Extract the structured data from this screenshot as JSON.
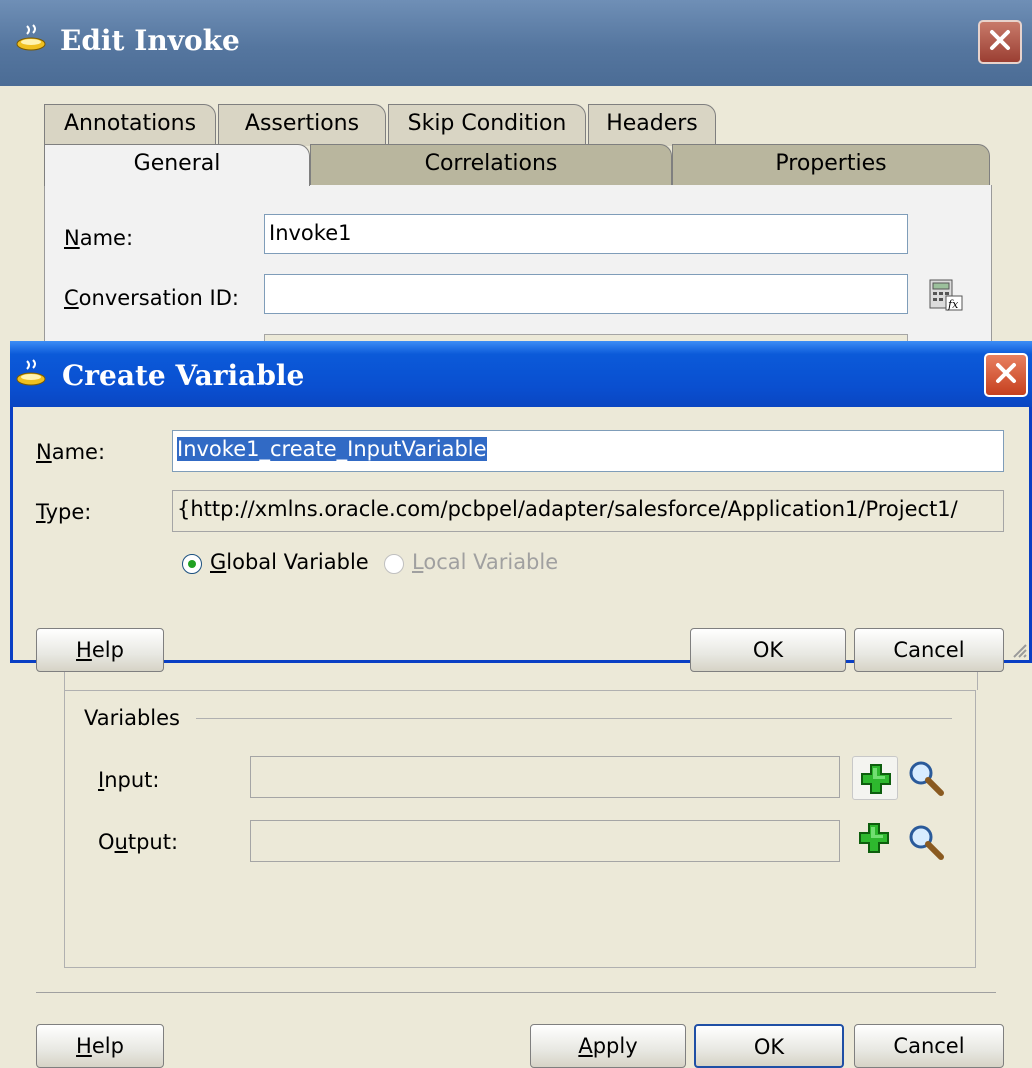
{
  "outer_dialog": {
    "title": "Edit Invoke",
    "tabs_row1": [
      "Annotations",
      "Assertions",
      "Skip Condition",
      "Headers"
    ],
    "tabs_row2": [
      "General",
      "Correlations",
      "Properties"
    ],
    "name_label": "Name:",
    "name_value": "Invoke1",
    "conversation_label": "Conversation ID:",
    "conversation_value": "",
    "variables": {
      "section_label": "Variables",
      "input_label": "Input:",
      "output_label": "Output:"
    },
    "buttons": {
      "help": "Help",
      "apply": "Apply",
      "ok": "OK",
      "cancel": "Cancel"
    }
  },
  "inner_dialog": {
    "title": "Create Variable",
    "name_label": "Name:",
    "name_value": "Invoke1_create_InputVariable",
    "type_label": "Type:",
    "type_value": "{http://xmlns.oracle.com/pcbpel/adapter/salesforce/Application1/Project1/",
    "radio_global": "Global Variable",
    "radio_local": "Local Variable",
    "buttons": {
      "help": "Help",
      "ok": "OK",
      "cancel": "Cancel"
    }
  },
  "icons": {
    "app_icon": "coffee-cup-icon",
    "expression_builder": "expression-builder-icon",
    "add": "green-plus-icon",
    "search": "magnifier-icon",
    "close": "close-x-icon"
  },
  "colors": {
    "xp_blue_title": "#0a4fd0",
    "inactive_title": "#55769f",
    "close_red": "#c6401f",
    "selection": "#316ac5",
    "dialog_bg": "#ece9d8"
  }
}
